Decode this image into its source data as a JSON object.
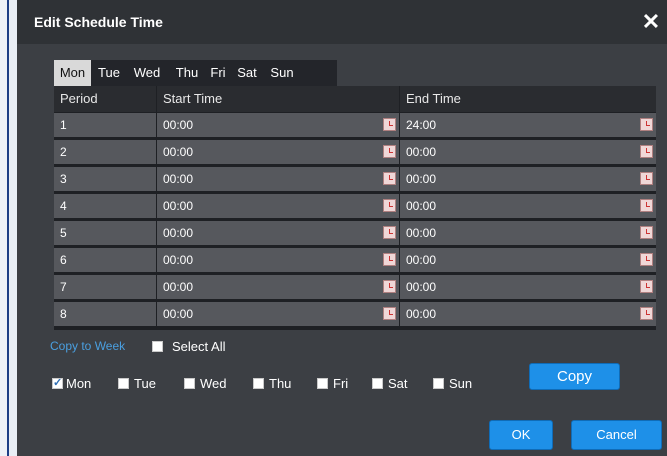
{
  "dialog": {
    "title": "Edit Schedule Time",
    "close_icon": "close-icon"
  },
  "tabs": [
    "Mon",
    "Tue",
    "Wed",
    "Thu",
    "Fri",
    "Sat",
    "Sun"
  ],
  "active_tab": "Mon",
  "table": {
    "headers": {
      "period": "Period",
      "start": "Start Time",
      "end": "End Time"
    },
    "rows": [
      {
        "period": "1",
        "start": "00:00",
        "end": "24:00"
      },
      {
        "period": "2",
        "start": "00:00",
        "end": "00:00"
      },
      {
        "period": "3",
        "start": "00:00",
        "end": "00:00"
      },
      {
        "period": "4",
        "start": "00:00",
        "end": "00:00"
      },
      {
        "period": "5",
        "start": "00:00",
        "end": "00:00"
      },
      {
        "period": "6",
        "start": "00:00",
        "end": "00:00"
      },
      {
        "period": "7",
        "start": "00:00",
        "end": "00:00"
      },
      {
        "period": "8",
        "start": "00:00",
        "end": "00:00"
      }
    ]
  },
  "copy_to_week": {
    "label": "Copy to Week",
    "select_all": {
      "label": "Select All",
      "checked": false
    },
    "days": [
      {
        "label": "Mon",
        "checked": true
      },
      {
        "label": "Tue",
        "checked": false
      },
      {
        "label": "Wed",
        "checked": false
      },
      {
        "label": "Thu",
        "checked": false
      },
      {
        "label": "Fri",
        "checked": false
      },
      {
        "label": "Sat",
        "checked": false
      },
      {
        "label": "Sun",
        "checked": false
      }
    ]
  },
  "buttons": {
    "copy": "Copy",
    "ok": "OK",
    "cancel": "Cancel"
  },
  "colors": {
    "dialog_bg": "#3c3f44",
    "titlebar_bg": "#2f3236",
    "accent": "#1e90e8",
    "link": "#4a9fe0",
    "cell_bg": "#56585d"
  }
}
